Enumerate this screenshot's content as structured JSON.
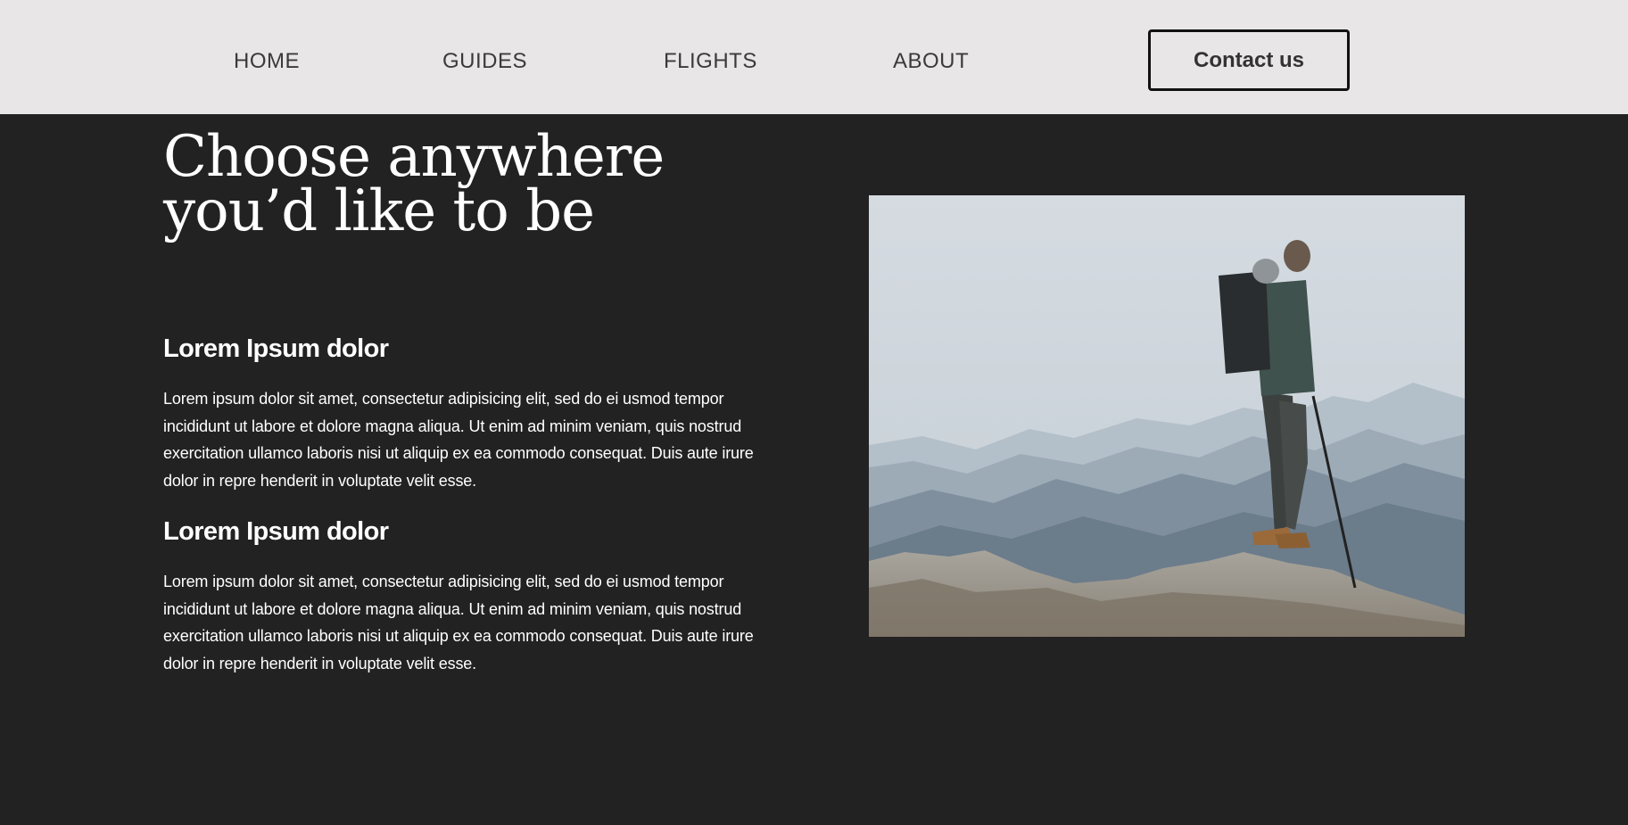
{
  "nav": {
    "items": [
      {
        "label": "HOME"
      },
      {
        "label": "GUIDES"
      },
      {
        "label": "FLIGHTS"
      },
      {
        "label": "ABOUT"
      }
    ],
    "contact_label": "Contact us"
  },
  "hero": {
    "title_line1": "Choose anywhere",
    "title_line2": "you’d like to be"
  },
  "sections": [
    {
      "heading": "Lorem Ipsum dolor",
      "body": "Lorem ipsum dolor sit amet, consectetur adipisicing elit, sed do ei usmod tempor incididunt ut labore et dolore magna aliqua. Ut enim ad minim veniam, quis nostrud exercitation ullamco laboris nisi ut aliquip ex ea commodo consequat. Duis aute irure dolor in repre henderit in voluptate velit esse."
    },
    {
      "heading": "Lorem Ipsum dolor",
      "body": "Lorem ipsum dolor sit amet, consectetur adipisicing elit, sed do ei usmod tempor incididunt ut labore et dolore magna aliqua. Ut enim ad minim veniam, quis nostrud exercitation ullamco laboris nisi ut aliquip ex ea commodo consequat. Duis aute irure dolor in repre henderit in voluptate velit esse."
    }
  ],
  "colors": {
    "page_background": "#222222",
    "navbar_background": "#e8e6e7",
    "text_light": "#ffffff",
    "nav_text": "#3a3a3a"
  }
}
